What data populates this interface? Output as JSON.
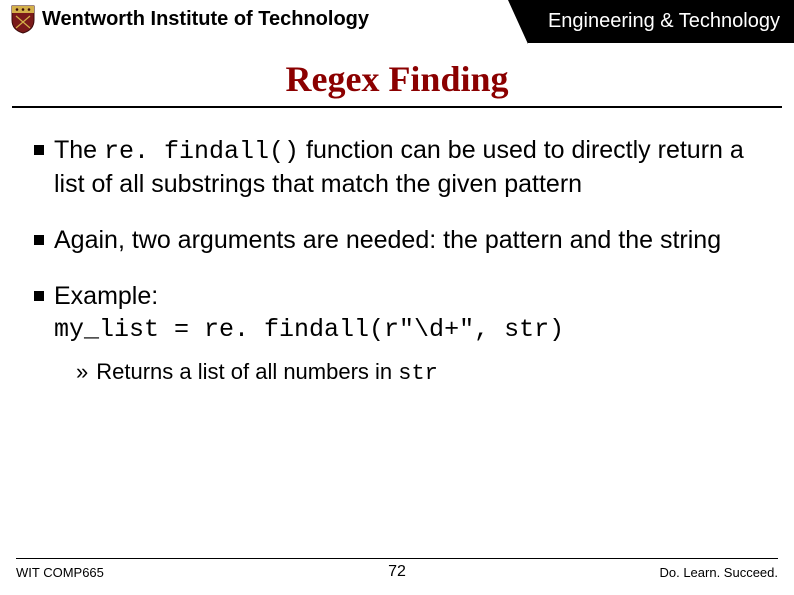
{
  "header": {
    "institution": "Wentworth Institute of Technology",
    "department": "Engineering & Technology"
  },
  "title": "Regex Finding",
  "bullets": {
    "b1_pre": "The ",
    "b1_code": "re. findall()",
    "b1_post": " function can be used to directly return a list of all substrings that match the given pattern",
    "b2": "Again, two arguments are needed: the pattern and the string",
    "b3_label": "Example:",
    "b3_code": "my_list = re. findall(r\"\\d+\", str)",
    "b3_sub_pre": "Returns a list of all numbers in ",
    "b3_sub_code": "str"
  },
  "footer": {
    "course": "WIT COMP665",
    "page": "72",
    "motto": "Do. Learn. Succeed."
  }
}
